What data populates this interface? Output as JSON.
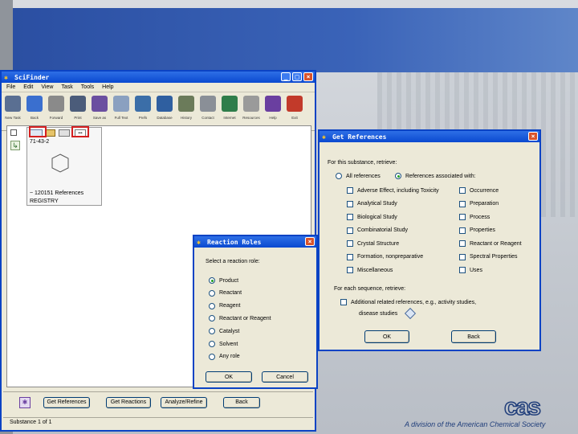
{
  "main_window": {
    "title": "SciFinder",
    "menu": [
      "File",
      "Edit",
      "View",
      "Task",
      "Tools",
      "Help"
    ],
    "toolbar": [
      {
        "label": "New Task",
        "icon": "new-task-icon",
        "color": "#5a6f92"
      },
      {
        "label": "Back",
        "icon": "back-arrow-icon",
        "color": "#3a6fcf"
      },
      {
        "label": "Forward",
        "icon": "forward-arrow-icon",
        "color": "#8a8a8a"
      },
      {
        "label": "Print",
        "icon": "print-icon",
        "color": "#4b5c7a"
      },
      {
        "label": "Save as",
        "icon": "save-as-icon",
        "color": "#6b4fa0"
      },
      {
        "label": "Full Text",
        "icon": "full-text-icon",
        "color": "#8aa0c0"
      },
      {
        "label": "Prefs",
        "icon": "preferences-icon",
        "color": "#3b6ea8"
      },
      {
        "label": "Database",
        "icon": "database-icon",
        "color": "#2f5fa0"
      },
      {
        "label": "History",
        "icon": "history-icon",
        "color": "#6b7b5a"
      },
      {
        "label": "Contact",
        "icon": "contact-mail-icon",
        "color": "#8a8f97"
      },
      {
        "label": "Internet",
        "icon": "internet-globe-icon",
        "color": "#2f7d4a"
      },
      {
        "label": "Resources",
        "icon": "resources-icon",
        "color": "#9a9a9a"
      },
      {
        "label": "Help",
        "icon": "help-icon",
        "color": "#6a3fa0"
      },
      {
        "label": "Exit",
        "icon": "exit-icon",
        "color": "#c23a2a"
      }
    ],
    "result": {
      "reg_number": "71-43-2",
      "references_text": "~ 120151 References",
      "registry_text": "REGISTRY"
    },
    "bottom_buttons": [
      "Get References",
      "Get Reactions",
      "Analyze/Refine",
      "Back"
    ],
    "status": "Substance 1 of 1"
  },
  "reaction_roles": {
    "title": "Reaction Roles",
    "prompt": "Select a reaction role:",
    "options": [
      "Product",
      "Reactant",
      "Reagent",
      "Reactant or Reagent",
      "Catalyst",
      "Solvent",
      "Any role"
    ],
    "selected": "Product",
    "ok_label": "OK",
    "cancel_label": "Cancel"
  },
  "get_references": {
    "title": "Get References",
    "prompt": "For this substance, retrieve:",
    "radio_all": "All references",
    "radio_assoc": "References associated with:",
    "selected": "References associated with:",
    "left_options": [
      "Adverse Effect, including Toxicity",
      "Analytical Study",
      "Biological Study",
      "Combinatorial Study",
      "Crystal Structure",
      "Formation, nonpreparative",
      "Miscellaneous"
    ],
    "right_options": [
      "Occurrence",
      "Preparation",
      "Process",
      "Properties",
      "Reactant or Reagent",
      "Spectral Properties",
      "Uses"
    ],
    "sequence_prompt": "For each sequence, retrieve:",
    "additional_line1": "Additional related references, e.g., activity studies,",
    "additional_line2": "disease studies",
    "ok_label": "OK",
    "back_label": "Back"
  },
  "footer": {
    "tagline": "A division of the American Chemical Society",
    "logo_text": "cas"
  }
}
